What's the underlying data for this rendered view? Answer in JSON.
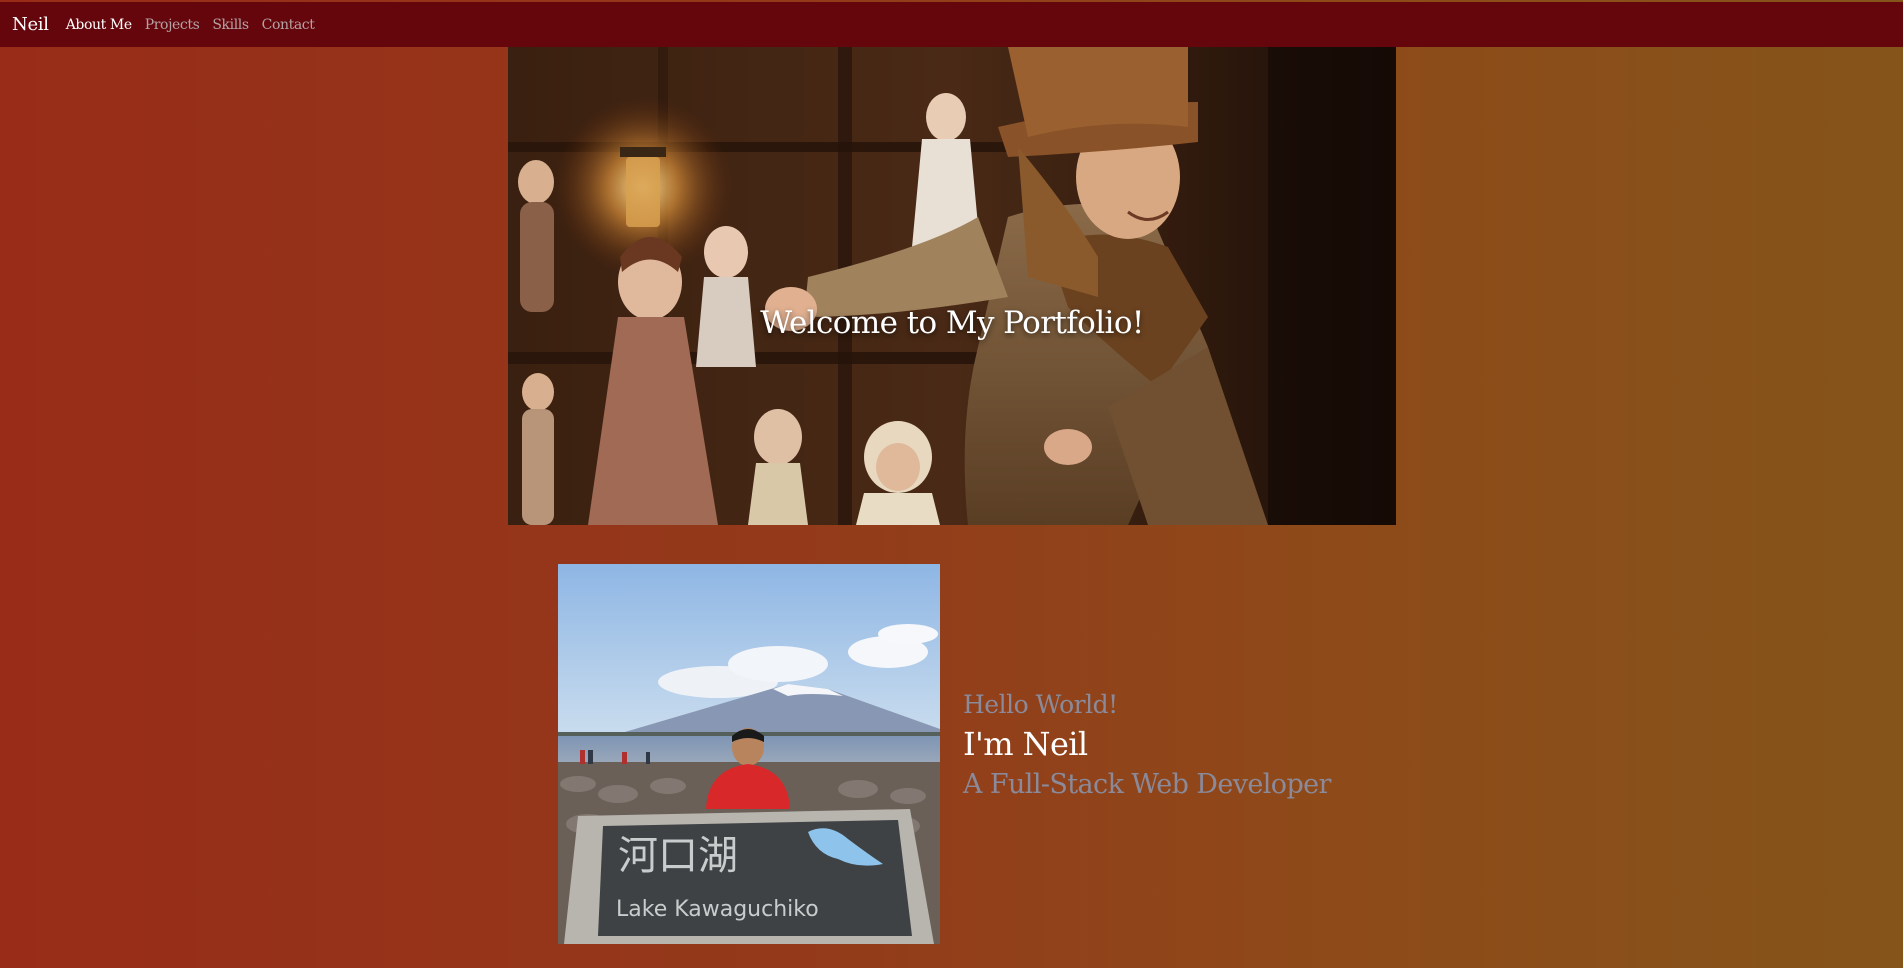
{
  "nav": {
    "brand": "Neil",
    "links": [
      {
        "label": "About Me",
        "active": true
      },
      {
        "label": "Projects",
        "active": false
      },
      {
        "label": "Skills",
        "active": false
      },
      {
        "label": "Contact",
        "active": false
      }
    ]
  },
  "hero": {
    "title": "Welcome to My Portfolio!",
    "image": "hero-photo-man-in-top-hat-with-dolls"
  },
  "about": {
    "photo": "profile-photo-lake-kawaguchiko",
    "sign_text": "河口湖",
    "sign_subtitle": "Lake Kawaguchiko",
    "greeting": "Hello World!",
    "name": "I'm Neil",
    "role": "A Full-Stack Web Developer"
  },
  "colors": {
    "navbar": "#65060d",
    "background_left": "#982c18",
    "background_right": "#85541a",
    "muted_text": "#8a8a9a"
  }
}
